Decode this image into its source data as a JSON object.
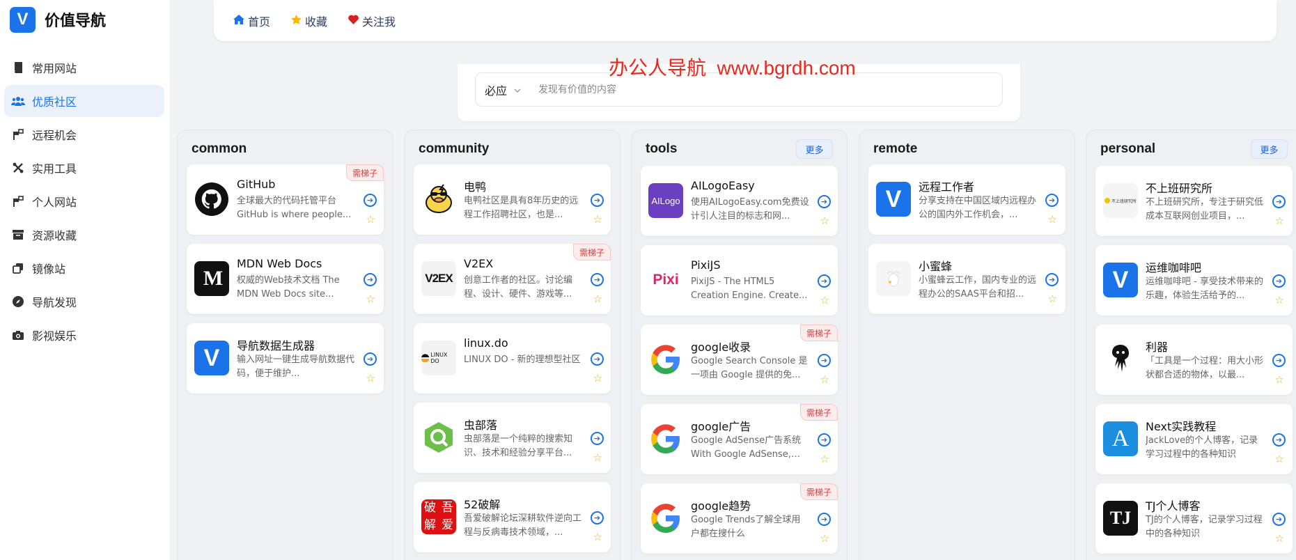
{
  "brand": {
    "logo_letter": "V",
    "title": "价值导航"
  },
  "sidebar": {
    "items": [
      {
        "label": "常用网站",
        "icon": "book-icon"
      },
      {
        "label": "优质社区",
        "icon": "users-icon",
        "active": true
      },
      {
        "label": "远程机会",
        "icon": "flag-icon"
      },
      {
        "label": "实用工具",
        "icon": "tools-icon"
      },
      {
        "label": "个人网站",
        "icon": "flag-icon"
      },
      {
        "label": "资源收藏",
        "icon": "archive-icon"
      },
      {
        "label": "镜像站",
        "icon": "copy-icon"
      },
      {
        "label": "导航发现",
        "icon": "compass-icon"
      },
      {
        "label": "影视娱乐",
        "icon": "camera-icon"
      }
    ]
  },
  "topbar": {
    "home": "首页",
    "favorites": "收藏",
    "follow": "关注我"
  },
  "watermark": "办公人导航  www.bgrdh.com",
  "search": {
    "engine": "必应",
    "placeholder": "发现有价值的内容"
  },
  "colors": {
    "accent": "#1a73e8",
    "tag_red": "#e03a3a",
    "star": "#f0b400"
  },
  "columns": [
    {
      "title": "common",
      "cards": [
        {
          "name": "GitHub",
          "desc": "全球最大的代码托管平台 GitHub is where people...",
          "tag": "需梯子"
        },
        {
          "name": "MDN Web Docs",
          "desc": "权威的Web技术文档 The MDN Web Docs site..."
        },
        {
          "name": "导航数据生成器",
          "desc": "输入网址一键生成导航数据代码，便于维护..."
        }
      ]
    },
    {
      "title": "community",
      "cards": [
        {
          "name": "电鸭",
          "desc": "电鸭社区是具有8年历史的远程工作招聘社区，也是..."
        },
        {
          "name": "V2EX",
          "desc": "创意工作者的社区。讨论编程、设计、硬件、游戏等...",
          "tag": "需梯子"
        },
        {
          "name": "linux.do",
          "desc": "LINUX DO - 新的理想型社区"
        },
        {
          "name": "虫部落",
          "desc": "虫部落是一个纯粹的搜索知识、技术和经验分享平台..."
        },
        {
          "name": "52破解",
          "desc": "吾爱破解论坛深耕软件逆向工程与反病毒技术领域，..."
        }
      ]
    },
    {
      "title": "tools",
      "more": "更多",
      "cards": [
        {
          "name": "AILogoEasy",
          "desc": "使用AILogoEasy.com免费设计引人注目的标志和网..."
        },
        {
          "name": "PixiJS",
          "desc": "PixiJS - The HTML5 Creation Engine. Create..."
        },
        {
          "name": "google收录",
          "desc": "Google Search Console 是一项由 Google 提供的免...",
          "tag": "需梯子"
        },
        {
          "name": "google广告",
          "desc": "Google AdSense广告系统 With Google AdSense, yo...",
          "tag": "需梯子"
        },
        {
          "name": "google趋势",
          "desc": "Google Trends了解全球用户都在搜什么",
          "tag": "需梯子"
        }
      ]
    },
    {
      "title": "remote",
      "cards": [
        {
          "name": "远程工作者",
          "desc": "分享支持在中国区域内远程办公的国内外工作机会，..."
        },
        {
          "name": "小蜜蜂",
          "desc": "小蜜蜂云工作，国内专业的远程办公的SAAS平台和招..."
        }
      ]
    },
    {
      "title": "personal",
      "more": "更多",
      "cards": [
        {
          "name": "不上班研究所",
          "desc": "不上班研究所，专注于研究低成本互联网创业项目，..."
        },
        {
          "name": "运维咖啡吧",
          "desc": "运维咖啡吧 - 享受技术带来的乐趣，体验生活给予的..."
        },
        {
          "name": "利器",
          "desc": "「工具是一个过程：用大小形状都合适的物体，以最..."
        },
        {
          "name": "Next实践教程",
          "desc": "JackLove的个人博客，记录学习过程中的各种知识"
        },
        {
          "name": "TJ个人博客",
          "desc": "TJ的个人博客，记录学习过程中的各种知识"
        }
      ]
    }
  ],
  "logo_text": {
    "mdn": "M",
    "v": "V",
    "v2ex": "V2EX",
    "linux": "LINUX DO",
    "ailogo": "AILogo",
    "pixi": "Pixi",
    "bushang": "不上班研究所",
    "a": "A",
    "tj": "TJ",
    "p52": [
      "破",
      "吾",
      "解",
      "爱"
    ]
  }
}
